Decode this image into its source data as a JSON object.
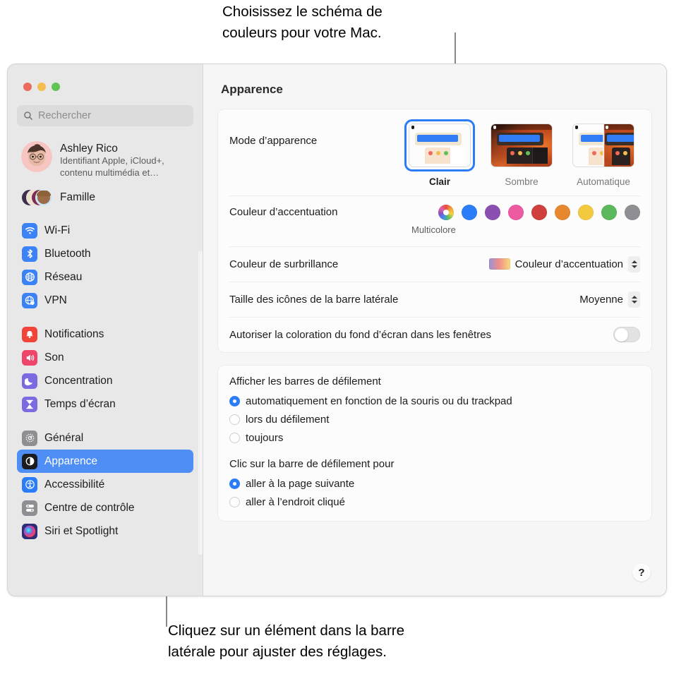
{
  "callouts": {
    "top": "Choisissez le schéma de\ncouleurs pour votre Mac.",
    "bottom": "Cliquez sur un élément dans la barre\nlatérale pour ajuster des réglages."
  },
  "window": {
    "title": "Apparence"
  },
  "sidebar": {
    "search_placeholder": "Rechercher",
    "account": {
      "name": "Ashley Rico",
      "subtitle": "Identifiant Apple, iCloud+,\ncontenu multimédia et…"
    },
    "family_label": "Famille",
    "groups": [
      {
        "items": [
          {
            "label": "Wi-Fi",
            "icon": "wifi-icon",
            "color": "#3b82f6"
          },
          {
            "label": "Bluetooth",
            "icon": "bluetooth-icon",
            "color": "#3b82f6"
          },
          {
            "label": "Réseau",
            "icon": "globe-icon",
            "color": "#3b82f6"
          },
          {
            "label": "VPN",
            "icon": "vpn-globe-icon",
            "color": "#3b82f6"
          }
        ]
      },
      {
        "items": [
          {
            "label": "Notifications",
            "icon": "bell-icon",
            "color": "#f04438"
          },
          {
            "label": "Son",
            "icon": "speaker-icon",
            "color": "#f0456b"
          },
          {
            "label": "Concentration",
            "icon": "moon-icon",
            "color": "#7a6ce0"
          },
          {
            "label": "Temps d’écran",
            "icon": "hourglass-icon",
            "color": "#7a6ce0"
          }
        ]
      },
      {
        "items": [
          {
            "label": "Général",
            "icon": "gear-icon",
            "color": "#8e8e93",
            "selected": false
          },
          {
            "label": "Apparence",
            "icon": "appearance-icon",
            "color": "#1c1c1e",
            "selected": true
          },
          {
            "label": "Accessibilité",
            "icon": "accessibility-icon",
            "color": "#2b7cf7",
            "selected": false
          },
          {
            "label": "Centre de contrôle",
            "icon": "control-center-icon",
            "color": "#8e8e93",
            "selected": false
          },
          {
            "label": "Siri et Spotlight",
            "icon": "siri-icon",
            "color": "#2d2d7a",
            "selected": false
          }
        ]
      }
    ]
  },
  "main": {
    "appearance_mode": {
      "label": "Mode d’apparence",
      "options": [
        {
          "label": "Clair",
          "value": "light",
          "selected": true
        },
        {
          "label": "Sombre",
          "value": "dark",
          "selected": false
        },
        {
          "label": "Automatique",
          "value": "auto",
          "selected": false
        }
      ]
    },
    "accent_color": {
      "label": "Couleur d’accentuation",
      "caption": "Multicolore",
      "swatches": [
        {
          "name": "multicolore",
          "color": "multi",
          "selected": true
        },
        {
          "name": "bleu",
          "color": "#2b7cf7"
        },
        {
          "name": "violet",
          "color": "#8a4fb0"
        },
        {
          "name": "rose",
          "color": "#ec5aa0"
        },
        {
          "name": "rouge",
          "color": "#cf3f3c"
        },
        {
          "name": "orange",
          "color": "#e8882e"
        },
        {
          "name": "jaune",
          "color": "#f3c93f"
        },
        {
          "name": "vert",
          "color": "#5cb85c"
        },
        {
          "name": "graphite",
          "color": "#8e8e93"
        }
      ]
    },
    "highlight_color": {
      "label": "Couleur de surbrillance",
      "value": "Couleur d’accentuation"
    },
    "sidebar_icon_size": {
      "label": "Taille des icônes de la barre latérale",
      "value": "Moyenne"
    },
    "wallpaper_tinting": {
      "label": "Autoriser la coloration du fond d’écran dans les fenêtres",
      "value": "off"
    },
    "show_scrollbars": {
      "title": "Afficher les barres de défilement",
      "options": [
        {
          "label": "automatiquement en fonction de la souris ou du trackpad",
          "selected": true
        },
        {
          "label": "lors du défilement",
          "selected": false
        },
        {
          "label": "toujours",
          "selected": false
        }
      ]
    },
    "click_scrollbar": {
      "title": "Clic sur la barre de défilement pour",
      "options": [
        {
          "label": "aller à la page suivante",
          "selected": true
        },
        {
          "label": "aller à l’endroit cliqué",
          "selected": false
        }
      ]
    },
    "help_label": "?"
  }
}
